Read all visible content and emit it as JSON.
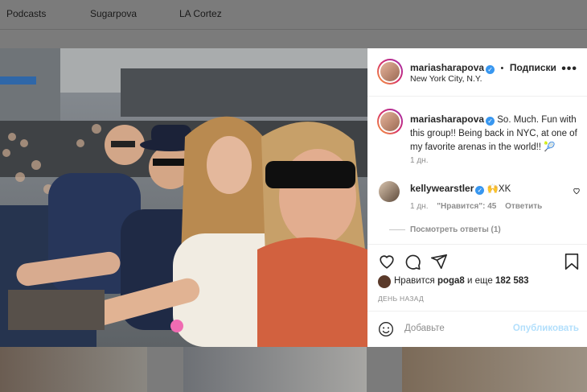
{
  "background_tabs": [
    "Podcasts",
    "Sugarpova",
    "LA Cortez"
  ],
  "post": {
    "author": "mariasharapova",
    "follow_label": "Подписки",
    "separator": "•",
    "location": "New York City, N.Y.",
    "more_icon": "more-horizontal-icon",
    "caption": "So. Much. Fun with this group!! Being back in NYC, at one of my favorite arenas in the world!! 🎾",
    "caption_time": "1 дн."
  },
  "comment": {
    "author": "kellywearstler",
    "text": "🙌XK",
    "time": "1 дн.",
    "likes_text": "\"Нравится\": 45",
    "reply_label": "Ответить",
    "view_replies": "Посмотреть ответы (1)"
  },
  "likes": {
    "prefix": "Нравится",
    "user": "poga8",
    "middle": "и еще",
    "count": "182 583"
  },
  "posted_ago": "ДЕНЬ НАЗАД",
  "add_comment": {
    "placeholder": "Добавьте",
    "publish_label": "Опубликовать"
  },
  "colors": {
    "verified": "#3897f0",
    "publish_disabled": "#b2dffc",
    "muted_text": "#8e8e8e",
    "overlay_bg": "#7b7b7b"
  }
}
